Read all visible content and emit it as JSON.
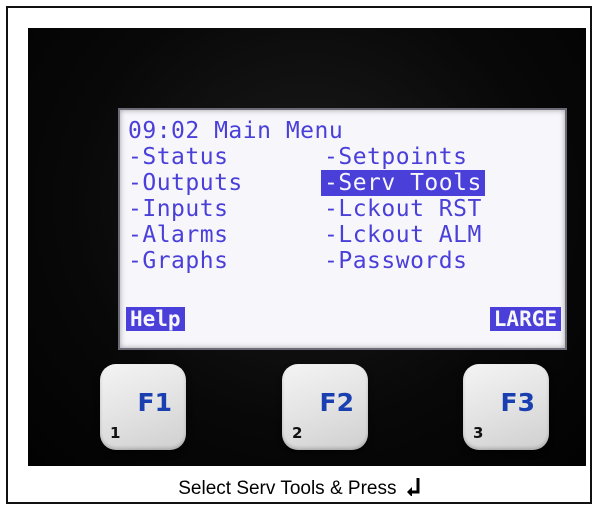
{
  "lcd": {
    "title": "09:02 Main Menu",
    "left_menu": [
      "-Status",
      "-Outputs",
      "-Inputs",
      "-Alarms",
      "-Graphs"
    ],
    "right_menu": [
      "-Setpoints",
      "-Serv Tools",
      "-Lckout RST",
      "-Lckout ALM",
      "-Passwords"
    ],
    "selected_item": "-Serv Tools",
    "softkey_left": "Help",
    "softkey_right": "LARGE"
  },
  "buttons": [
    {
      "label": "F1",
      "number": "1"
    },
    {
      "label": "F2",
      "number": "2"
    },
    {
      "label": "F3",
      "number": "3"
    }
  ],
  "caption": {
    "text": "Select Serv Tools & Press",
    "icon": "enter-return-icon"
  },
  "colors": {
    "lcd_text": "#4a3fd8",
    "lcd_background": "#f6f6fb",
    "button_label": "#1a3fb0"
  }
}
